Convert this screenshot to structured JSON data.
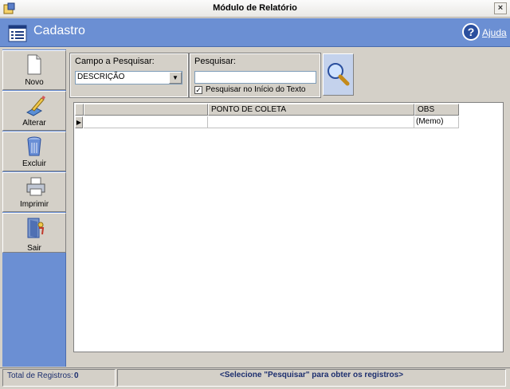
{
  "window": {
    "title": "Módulo de Relatório",
    "close_label": "×"
  },
  "header": {
    "title": "Cadastro",
    "help_label": "Ajuda"
  },
  "toolbar": {
    "items": [
      {
        "label": "Novo",
        "icon": "new-document-icon"
      },
      {
        "label": "Alterar",
        "icon": "edit-icon"
      },
      {
        "label": "Excluir",
        "icon": "trash-icon"
      },
      {
        "label": "Imprimir",
        "icon": "printer-icon"
      },
      {
        "label": "Sair",
        "icon": "exit-door-icon"
      }
    ]
  },
  "search": {
    "field_label": "Campo a Pesquisar:",
    "field_value": "DESCRIÇÃO",
    "query_label": "Pesquisar:",
    "query_value": "",
    "checkbox_label": "Pesquisar no Início do Texto",
    "checkbox_checked": true,
    "checkbox_mark": "✓"
  },
  "grid": {
    "columns": [
      "",
      "PONTO DE COLETA",
      "OBS"
    ],
    "rows": [
      [
        "",
        "",
        "(Memo)"
      ]
    ],
    "row_marker": "▶"
  },
  "status": {
    "total_label": "Total de Registros:",
    "total_value": "0",
    "message": "<Selecione \"Pesquisar\" para obter os registros>"
  },
  "colors": {
    "accent": "#6b8fd3",
    "status_text": "#1c2e6e"
  }
}
